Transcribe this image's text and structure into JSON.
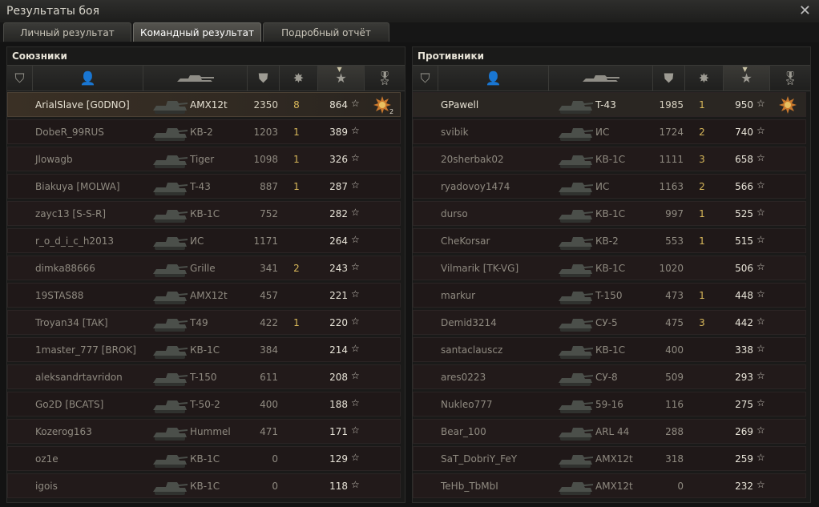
{
  "window": {
    "title": "Результаты боя"
  },
  "tabs": [
    "Личный результат",
    "Командный результат",
    "Подробный отчёт"
  ],
  "allies": {
    "title": "Союзники",
    "rows": [
      {
        "name": "ArialSlave [G0DNO]",
        "vehicle": "AMX12t",
        "damage": "2350",
        "kills": "8",
        "xp": "864",
        "medal_count": "2"
      },
      {
        "name": "DobeR_99RUS",
        "vehicle": "КВ-2",
        "damage": "1203",
        "kills": "1",
        "xp": "389"
      },
      {
        "name": "Jlowagb",
        "vehicle": "Tiger",
        "damage": "1098",
        "kills": "1",
        "xp": "326"
      },
      {
        "name": "Biakuya [MOLWA]",
        "vehicle": "T-43",
        "damage": "887",
        "kills": "1",
        "xp": "287"
      },
      {
        "name": "zayc13 [S-S-R]",
        "vehicle": "КВ-1С",
        "damage": "752",
        "kills": "",
        "xp": "282"
      },
      {
        "name": "r_o_d_i_c_h2013",
        "vehicle": "ИС",
        "damage": "1171",
        "kills": "",
        "xp": "264"
      },
      {
        "name": "dimka88666",
        "vehicle": "Grille",
        "damage": "341",
        "kills": "2",
        "xp": "243"
      },
      {
        "name": "19STAS88",
        "vehicle": "AMX12t",
        "damage": "457",
        "kills": "",
        "xp": "221"
      },
      {
        "name": "Troyan34 [TAK]",
        "vehicle": "T49",
        "damage": "422",
        "kills": "1",
        "xp": "220"
      },
      {
        "name": "1master_777 [BROK]",
        "vehicle": "КВ-1С",
        "damage": "384",
        "kills": "",
        "xp": "214"
      },
      {
        "name": "aleksandrtavridon",
        "vehicle": "T-150",
        "damage": "611",
        "kills": "",
        "xp": "208"
      },
      {
        "name": "Go2D [BCATS]",
        "vehicle": "T-50-2",
        "damage": "400",
        "kills": "",
        "xp": "188"
      },
      {
        "name": "Kozerog163",
        "vehicle": "Hummel",
        "damage": "471",
        "kills": "",
        "xp": "171"
      },
      {
        "name": "oz1e",
        "vehicle": "КВ-1С",
        "damage": "0",
        "kills": "",
        "xp": "129"
      },
      {
        "name": "igois",
        "vehicle": "КВ-1С",
        "damage": "0",
        "kills": "",
        "xp": "118"
      }
    ]
  },
  "enemies": {
    "title": "Противники",
    "rows": [
      {
        "name": "GPawell",
        "vehicle": "T-43",
        "damage": "1985",
        "kills": "1",
        "xp": "950"
      },
      {
        "name": "svibik",
        "vehicle": "ИС",
        "damage": "1724",
        "kills": "2",
        "xp": "740"
      },
      {
        "name": "20sherbak02",
        "vehicle": "КВ-1С",
        "damage": "1111",
        "kills": "3",
        "xp": "658"
      },
      {
        "name": "ryadovoy1474",
        "vehicle": "ИС",
        "damage": "1163",
        "kills": "2",
        "xp": "566"
      },
      {
        "name": "durso",
        "vehicle": "КВ-1С",
        "damage": "997",
        "kills": "1",
        "xp": "525"
      },
      {
        "name": "CheKorsar",
        "vehicle": "КВ-2",
        "damage": "553",
        "kills": "1",
        "xp": "515"
      },
      {
        "name": "Vilmarik [TK-VG]",
        "vehicle": "КВ-1С",
        "damage": "1020",
        "kills": "",
        "xp": "506"
      },
      {
        "name": "markur",
        "vehicle": "T-150",
        "damage": "473",
        "kills": "1",
        "xp": "448"
      },
      {
        "name": "Demid3214",
        "vehicle": "СУ-5",
        "damage": "475",
        "kills": "3",
        "xp": "442"
      },
      {
        "name": "santaclauscz",
        "vehicle": "КВ-1С",
        "damage": "400",
        "kills": "",
        "xp": "338"
      },
      {
        "name": "ares0223",
        "vehicle": "СУ-8",
        "damage": "509",
        "kills": "",
        "xp": "293"
      },
      {
        "name": "Nukleo777",
        "vehicle": "59-16",
        "damage": "116",
        "kills": "",
        "xp": "275"
      },
      {
        "name": "Bear_100",
        "vehicle": "ARL 44",
        "damage": "288",
        "kills": "",
        "xp": "269"
      },
      {
        "name": "SaT_DobriY_FeY",
        "vehicle": "AMX12t",
        "damage": "318",
        "kills": "",
        "xp": "259"
      },
      {
        "name": "TeHb_TbMbI",
        "vehicle": "AMX12t",
        "damage": "0",
        "kills": "",
        "xp": "232"
      }
    ]
  },
  "icons": {
    "close": "close-icon",
    "squad": "squad-icon",
    "player": "player-icon",
    "tank": "tank-icon",
    "damage": "shield-damage-icon",
    "kills": "destroyed-tank-icon",
    "xp": "star-icon",
    "medal": "medal-icon"
  },
  "colors": {
    "kills": "#d8b85a",
    "self_row": "#3a3025"
  }
}
